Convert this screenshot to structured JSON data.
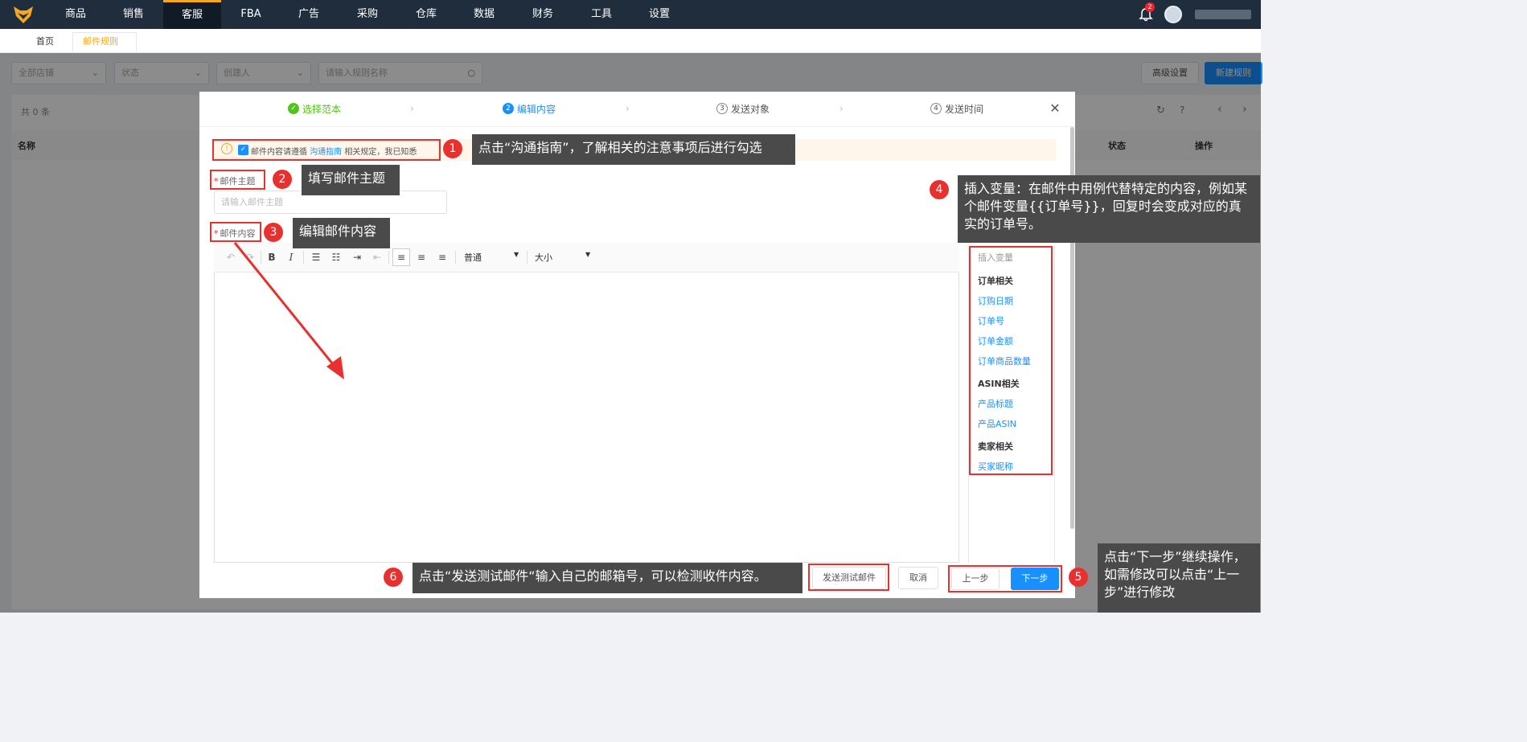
{
  "topnav": {
    "items": [
      "商品",
      "销售",
      "客服",
      "FBA",
      "广告",
      "采购",
      "仓库",
      "数据",
      "财务",
      "工具",
      "设置"
    ],
    "active_index": 2,
    "notification_count": "2"
  },
  "tabs": [
    "首页",
    "邮件规则"
  ],
  "tab_close": "×",
  "filters": {
    "shop": "全部店铺",
    "status": "状态",
    "creator": "创建人",
    "search_placeholder": "请输入规则名称"
  },
  "page_buttons": {
    "advanced": "高级设置",
    "new_rule": "新建规则"
  },
  "list": {
    "count": "共 0 条",
    "col_name": "名称",
    "col_status": "状态",
    "col_action": "操作"
  },
  "steps": [
    {
      "num": "✓",
      "label": "选择范本"
    },
    {
      "num": "2",
      "label": "编辑内容"
    },
    {
      "num": "3",
      "label": "发送对象"
    },
    {
      "num": "4",
      "label": "发送时间"
    }
  ],
  "notice": {
    "prefix": "邮件内容请遵循",
    "link": "沟通指南",
    "suffix": "相关规定，我已知悉"
  },
  "form": {
    "subject_label": "邮件主题",
    "subject_placeholder": "请输入邮件主题",
    "content_label": "邮件内容",
    "format_select": "普通",
    "size_select": "大小"
  },
  "variables": {
    "title": "插入变量",
    "groups": [
      {
        "heading": "订单相关",
        "items": [
          "订购日期",
          "订单号",
          "订单金额",
          "订单商品数量"
        ]
      },
      {
        "heading": "ASIN相关",
        "items": [
          "产品标题",
          "产品ASIN"
        ]
      },
      {
        "heading": "卖家相关",
        "items": [
          "买家昵称"
        ]
      }
    ]
  },
  "footer": {
    "test_mail": "发送测试邮件",
    "cancel": "取消",
    "prev": "上一步",
    "next": "下一步"
  },
  "annotations": [
    {
      "num": "1",
      "text": "点击“沟通指南”，了解相关的注意事项后进行勾选"
    },
    {
      "num": "2",
      "text": "填写邮件主题"
    },
    {
      "num": "3",
      "text": "编辑邮件内容"
    },
    {
      "num": "4",
      "text": "插入变量：在邮件中用例代替特定的内容，例如某个邮件变量{{订单号}}，回复时会变成对应的真实的订单号。"
    },
    {
      "num": "5",
      "text": "点击“下一步”继续操作，如需修改可以点击“上一步”进行修改"
    },
    {
      "num": "6",
      "text": "点击“发送测试邮件“输入自己的邮箱号，可以检测收件内容。"
    }
  ],
  "colors": {
    "accent": "#1890ff",
    "success": "#52c41a",
    "annotation_red": "#e8312f",
    "nav_bg": "#1f2d3d",
    "active_tab": "#f5a623"
  }
}
